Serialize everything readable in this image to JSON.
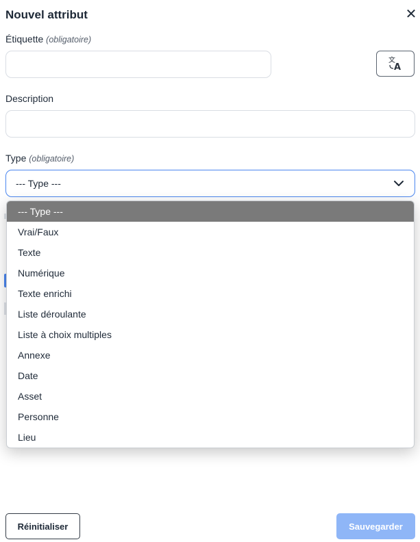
{
  "dialog": {
    "title": "Nouvel attribut",
    "close_icon": "close-icon"
  },
  "fields": {
    "label": {
      "text": "Étiquette",
      "required": "(obligatoire)",
      "value": "",
      "placeholder": ""
    },
    "translate_icon": "translate-icon",
    "description": {
      "text": "Description",
      "value": "",
      "placeholder": ""
    },
    "type": {
      "text": "Type",
      "required": "(obligatoire)",
      "selected": "--- Type ---",
      "chevron_icon": "chevron-down-icon"
    }
  },
  "dropdown": {
    "options": [
      "--- Type ---",
      "Vrai/Faux",
      "Texte",
      "Numérique",
      "Texte enrichi",
      "Liste déroulante",
      "Liste à choix multiples",
      "Annexe",
      "Date",
      "Asset",
      "Personne",
      "Lieu"
    ],
    "highlighted_index": 0
  },
  "footer": {
    "reset_label": "Réinitialiser",
    "save_label": "Sauvegarder"
  },
  "colors": {
    "accent": "#4a86f0",
    "save_disabled": "#8fb6f7",
    "highlight": "#7a7a7a"
  }
}
